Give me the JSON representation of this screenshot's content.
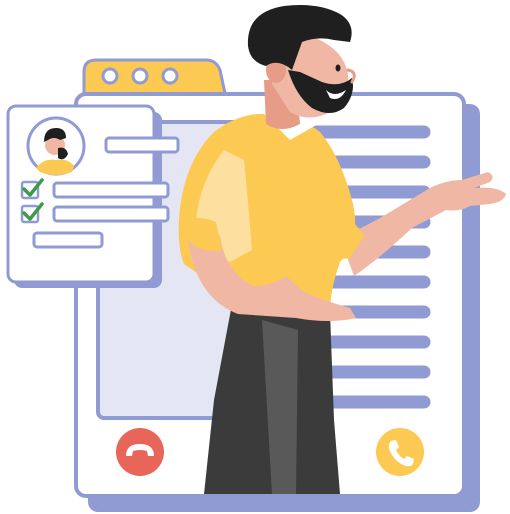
{
  "colors": {
    "window_fill": "#ffffff",
    "window_border": "#8f9bd2",
    "window_shadow": "#8f9bd2",
    "tab_yellow": "#fcc952",
    "tab_dot_fill": "#ffffff",
    "tab_dot_border": "#8f9bd2",
    "screen_fill": "#e4e6f4",
    "text_line": "#8f9bd2",
    "hangup_red": "#e8655a",
    "answer_yellow": "#fcc952",
    "card_border": "#8f9bd2",
    "check_green": "#3f9a4a",
    "skin": "#f0b8a4",
    "skin_shadow": "#e69c86",
    "hair": "#1f1f1f",
    "shirt": "#fcc952",
    "shirt_light": "#fde0a0",
    "pants": "#3b3b3b",
    "pants_light": "#595959"
  },
  "icons": {
    "window_dots": [
      "window-dot-icon",
      "window-dot-icon",
      "window-dot-icon"
    ],
    "hangup": "phone-hangup-icon",
    "answer": "phone-answer-icon",
    "avatar": "avatar-icon",
    "check": "check-icon"
  },
  "checklist": {
    "items": [
      {
        "checked": true
      },
      {
        "checked": true
      }
    ]
  }
}
